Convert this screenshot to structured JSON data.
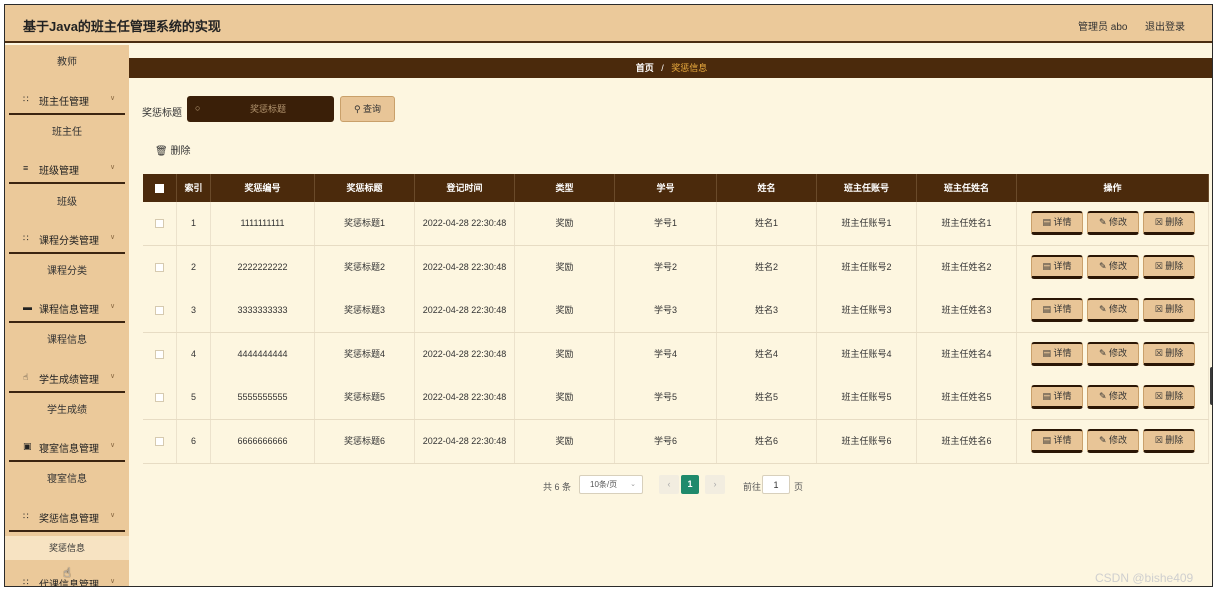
{
  "header": {
    "title": "基于Java的班主任管理系统的实现",
    "admin": "管理员 abo",
    "logout": "退出登录"
  },
  "sidebar": {
    "items": [
      {
        "type": "sub",
        "label": "教师"
      },
      {
        "type": "menu",
        "label": "班主任管理",
        "icon": "grid-icon"
      },
      {
        "type": "sub",
        "label": "班主任"
      },
      {
        "type": "menu",
        "label": "班级管理",
        "icon": "list-icon"
      },
      {
        "type": "sub",
        "label": "班级"
      },
      {
        "type": "menu",
        "label": "课程分类管理",
        "icon": "grid-icon"
      },
      {
        "type": "sub",
        "label": "课程分类"
      },
      {
        "type": "menu",
        "label": "课程信息管理",
        "icon": "book-icon"
      },
      {
        "type": "sub",
        "label": "课程信息"
      },
      {
        "type": "menu",
        "label": "学生成绩管理",
        "icon": "thumb-icon"
      },
      {
        "type": "sub",
        "label": "学生成绩"
      },
      {
        "type": "menu",
        "label": "寝室信息管理",
        "icon": "building-icon"
      },
      {
        "type": "sub",
        "label": "寝室信息"
      },
      {
        "type": "menu",
        "label": "奖惩信息管理",
        "icon": "grid-icon"
      },
      {
        "type": "sub",
        "label": "奖惩信息",
        "active": true
      },
      {
        "type": "menu",
        "label": "代课信息管理",
        "icon": "grid-icon"
      }
    ]
  },
  "breadcrumb": {
    "home": "首页",
    "separator": "/",
    "current": "奖惩信息"
  },
  "search": {
    "label": "奖惩标题",
    "placeholder": "奖惩标题",
    "query_button": "查询",
    "delete_button": "删除"
  },
  "table": {
    "headers": {
      "index": "索引",
      "code": "奖惩编号",
      "title": "奖惩标题",
      "time": "登记时间",
      "type": "类型",
      "student_no": "学号",
      "name": "姓名",
      "teacher_account": "班主任账号",
      "teacher_name": "班主任姓名",
      "actions": "操作"
    },
    "action_labels": {
      "detail": "详情",
      "edit": "修改",
      "delete": "删除"
    },
    "rows": [
      {
        "index": "1",
        "code": "1111111111",
        "title": "奖惩标题1",
        "time": "2022-04-28 22:30:48",
        "type": "奖励",
        "student_no": "学号1",
        "name": "姓名1",
        "teacher_account": "班主任账号1",
        "teacher_name": "班主任姓名1"
      },
      {
        "index": "2",
        "code": "2222222222",
        "title": "奖惩标题2",
        "time": "2022-04-28 22:30:48",
        "type": "奖励",
        "student_no": "学号2",
        "name": "姓名2",
        "teacher_account": "班主任账号2",
        "teacher_name": "班主任姓名2"
      },
      {
        "index": "3",
        "code": "3333333333",
        "title": "奖惩标题3",
        "time": "2022-04-28 22:30:48",
        "type": "奖励",
        "student_no": "学号3",
        "name": "姓名3",
        "teacher_account": "班主任账号3",
        "teacher_name": "班主任姓名3"
      },
      {
        "index": "4",
        "code": "4444444444",
        "title": "奖惩标题4",
        "time": "2022-04-28 22:30:48",
        "type": "奖励",
        "student_no": "学号4",
        "name": "姓名4",
        "teacher_account": "班主任账号4",
        "teacher_name": "班主任姓名4"
      },
      {
        "index": "5",
        "code": "5555555555",
        "title": "奖惩标题5",
        "time": "2022-04-28 22:30:48",
        "type": "奖励",
        "student_no": "学号5",
        "name": "姓名5",
        "teacher_account": "班主任账号5",
        "teacher_name": "班主任姓名5"
      },
      {
        "index": "6",
        "code": "6666666666",
        "title": "奖惩标题6",
        "time": "2022-04-28 22:30:48",
        "type": "奖励",
        "student_no": "学号6",
        "name": "姓名6",
        "teacher_account": "班主任账号6",
        "teacher_name": "班主任姓名6"
      }
    ]
  },
  "pagination": {
    "total": "共 6 条",
    "page_size": "10条/页",
    "current_page": "1",
    "jump_prefix": "前往",
    "jump_value": "1",
    "jump_suffix": "页"
  },
  "watermark": "CSDN @bishe409",
  "colors": {
    "header_bg": "#ebc99a",
    "dark_brown": "#4b2a0c",
    "content_bg": "#fdf6e0",
    "button_bg": "#e8c597",
    "active_page": "#1f8a6c",
    "breadcrumb_current": "#f0b040"
  }
}
